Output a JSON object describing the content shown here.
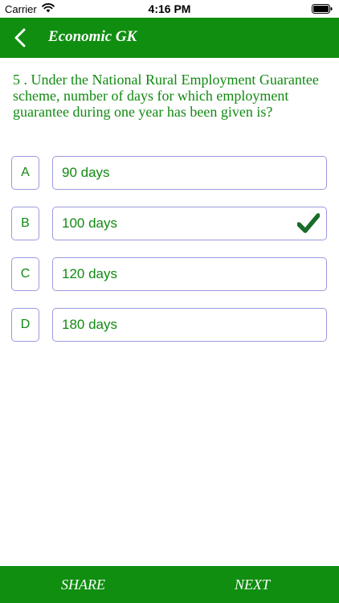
{
  "status_bar": {
    "carrier": "Carrier",
    "time": "4:16 PM",
    "icons": [
      "wifi-icon",
      "battery-icon"
    ]
  },
  "nav": {
    "title": "Economic GK",
    "back_icon": "chevron-left-icon"
  },
  "question": {
    "text": "5 . Under the National Rural Employment Guarantee scheme, number of days for which employment guarantee during one year has been given is?"
  },
  "options": [
    {
      "letter": "A",
      "text": "90 days",
      "correct": false
    },
    {
      "letter": "B",
      "text": "100 days",
      "correct": true
    },
    {
      "letter": "C",
      "text": "120 days",
      "correct": false
    },
    {
      "letter": "D",
      "text": "180 days",
      "correct": false
    }
  ],
  "bottom_bar": {
    "share_label": "SHARE",
    "next_label": "NEXT"
  },
  "colors": {
    "brand_green": "#108e10",
    "text_green": "#118a11",
    "border": "#9b9bde",
    "check": "#1b6b2a"
  }
}
